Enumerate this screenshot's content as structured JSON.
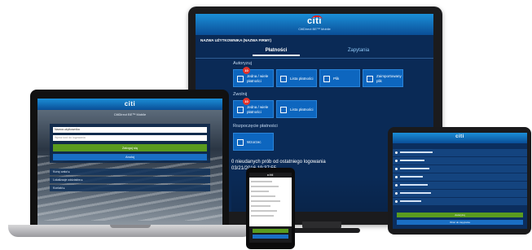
{
  "brand": {
    "logo": "citi",
    "accent": "#0d66bf",
    "header_gradient": [
      "#1b8fd8",
      "#0a4e97"
    ],
    "alert": "#e5332a",
    "green": "#5a9b1e"
  },
  "monitor": {
    "app_subtitle": "CitiDirect BE™ Mobile",
    "username": "NAZWA UŻYTKOWNIKA (NAZWA FIRMY)",
    "tabs": [
      {
        "label": "Płatności",
        "active": true
      },
      {
        "label": "Zapytania",
        "active": false
      }
    ],
    "sections": [
      {
        "label": "Autoryzuj",
        "tiles": [
          {
            "label": "Jedna / wiele płatności",
            "badge": "10",
            "icon": "payments-icon"
          },
          {
            "label": "Lista płatności",
            "icon": "list-icon"
          },
          {
            "label": "Plik",
            "icon": "file-icon"
          },
          {
            "label": "Zaimportowany plik",
            "icon": "folder-icon"
          }
        ]
      },
      {
        "label": "Zwolnij",
        "tiles": [
          {
            "label": "Jedna / wiele płatności",
            "badge": "10",
            "icon": "payments-icon"
          },
          {
            "label": "Lista płatności",
            "icon": "list-icon"
          }
        ]
      },
      {
        "label": "Rozpoczęcie płatności",
        "tiles": [
          {
            "label": "Wzorzec",
            "icon": "template-icon"
          }
        ]
      }
    ],
    "info_line1": "0 nieudanych prób od ostatniego logowania",
    "info_line2": "03/21/2016 19:37:55"
  },
  "laptop": {
    "title": "CitiDirect BE™ Mobile",
    "username_value": "Nazwa użytkownika",
    "password_placeholder": "Wpisz kod do logowania",
    "login_button": "Zaloguj się",
    "secondary_button": "Anuluj",
    "rows": [
      "Kursy walut ▸",
      "Lokalizacje oddziałów ▸",
      "Kontakt ▸"
    ]
  },
  "phone": {
    "logo": "citi"
  },
  "tablet": {
    "logo": "citi",
    "green_button": "Autoryzuj",
    "blue_button": "Wróć do zapytania"
  }
}
